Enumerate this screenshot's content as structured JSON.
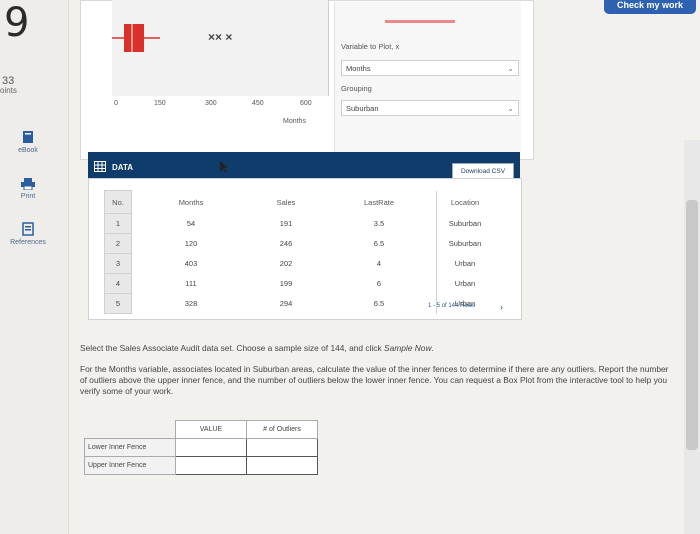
{
  "question_number": "9",
  "points": {
    "value": "33",
    "label": "oints"
  },
  "rail": [
    {
      "label": "eBook",
      "icon": "book-icon"
    },
    {
      "label": "Print",
      "icon": "printer-icon"
    },
    {
      "label": "References",
      "icon": "references-icon"
    }
  ],
  "check_button": "Check my work",
  "plot": {
    "x_ticks": [
      "0",
      "150",
      "300",
      "450",
      "600"
    ],
    "x_label": "Months",
    "outlier_marks": "×× ×"
  },
  "controls": {
    "variable_label": "Variable to Plot, x",
    "variable_value": "Months",
    "grouping_label": "Grouping",
    "grouping_value": "Suburban"
  },
  "data_panel": {
    "title": "DATA",
    "download_label": "Download CSV",
    "columns": [
      "No.",
      "Months",
      "Sales",
      "LastRate",
      "Location"
    ],
    "rows": [
      [
        "1",
        "54",
        "191",
        "3.5",
        "Suburban"
      ],
      [
        "2",
        "120",
        "246",
        "6.5",
        "Suburban"
      ],
      [
        "3",
        "403",
        "202",
        "4",
        "Urban"
      ],
      [
        "4",
        "111",
        "199",
        "6",
        "Urban"
      ],
      [
        "5",
        "328",
        "294",
        "6.5",
        "Urban"
      ]
    ],
    "rows_info": "1 - 5 of 144 Rows"
  },
  "instructions": {
    "p1_text": "Select the Sales Associate Audit data set. Choose a sample size of 144, and click ",
    "p1_em": "Sample Now",
    "p1_end": ".",
    "p2": "For the Months variable, associates located in Suburban areas, calculate the value of the inner fences to determine if there are any outliers. Report the number of outliers above the upper inner fence, and the number of outliers below the lower inner fence. You can request a Box Plot from the interactive tool to help you verify some of your work."
  },
  "answer_table": {
    "headers": [
      "VALUE",
      "# of Outliers"
    ],
    "rows": [
      "Lower Inner Fence",
      "Upper Inner Fence"
    ]
  },
  "colors": {
    "header_bar": "#0f3c6b",
    "button": "#2e62b0",
    "box": "#d9302a"
  }
}
